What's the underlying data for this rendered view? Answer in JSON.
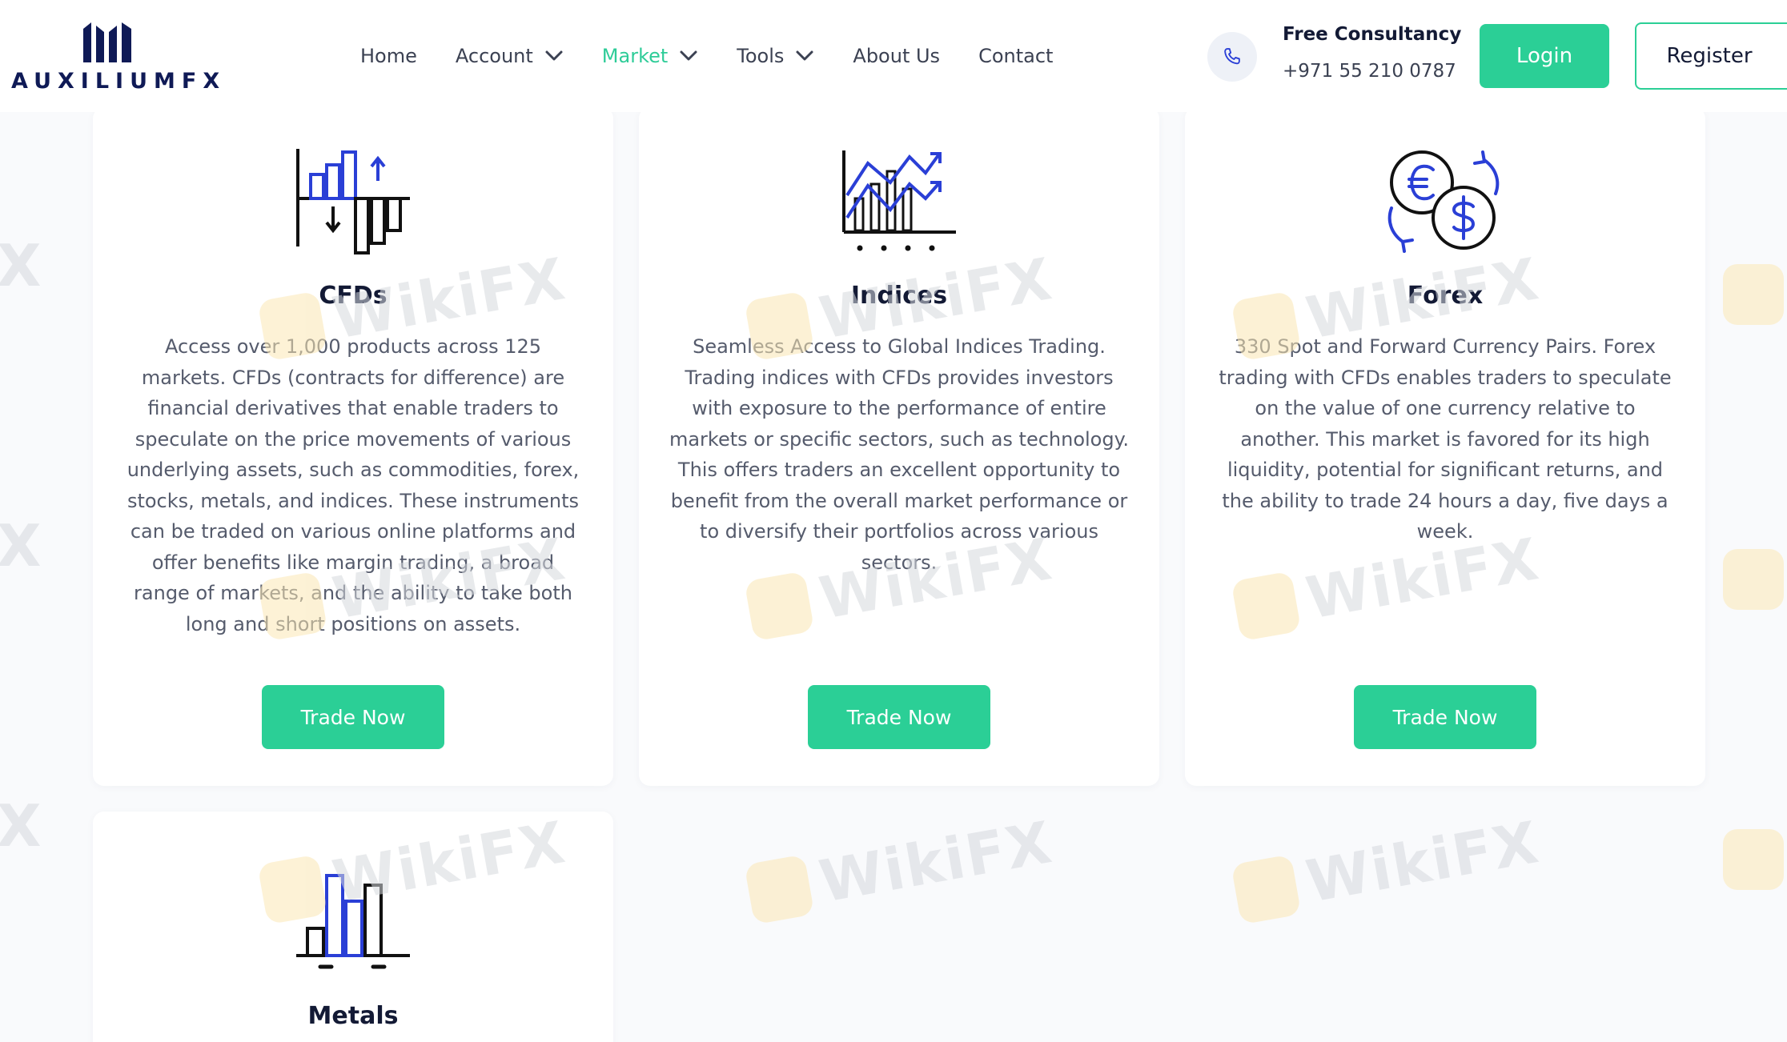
{
  "brand": {
    "name": "AUXILIUMFX",
    "colors": {
      "primary": "#2bcf96",
      "navy": "#0f1a56",
      "icon_blue": "#2a3fd6"
    }
  },
  "nav": {
    "items": [
      {
        "label": "Home",
        "dropdown": false,
        "active": false
      },
      {
        "label": "Account",
        "dropdown": true,
        "active": false
      },
      {
        "label": "Market",
        "dropdown": true,
        "active": true
      },
      {
        "label": "Tools",
        "dropdown": true,
        "active": false
      },
      {
        "label": "About Us",
        "dropdown": false,
        "active": false
      },
      {
        "label": "Contact",
        "dropdown": false,
        "active": false
      }
    ]
  },
  "contact": {
    "icon": "phone-icon",
    "title": "Free Consultancy",
    "phone": "+971 55 210 0787"
  },
  "auth": {
    "login_label": "Login",
    "register_label": "Register"
  },
  "markets": [
    {
      "icon": "cfd-bar-chart-icon",
      "title": "CFDs",
      "description": "Access over 1,000 products across 125 markets. CFDs (contracts for difference) are financial derivatives that enable traders to speculate on the price movements of various underlying assets, such as commodities, forex, stocks, metals, and indices. These instruments can be traded on various online platforms and offer benefits like margin trading, a broad range of markets, and the ability to take both long and short positions on assets.",
      "button_label": "Trade Now"
    },
    {
      "icon": "indices-line-chart-icon",
      "title": "Indices",
      "description": "Seamless Access to Global Indices Trading. Trading indices with CFDs provides investors with exposure to the performance of entire markets or specific sectors, such as technology. This offers traders an excellent opportunity to benefit from the overall market performance or to diversify their portfolios across various sectors.",
      "button_label": "Trade Now"
    },
    {
      "icon": "currency-exchange-icon",
      "title": "Forex",
      "description": "330 Spot and Forward Currency Pairs. Forex trading with CFDs enables traders to speculate on the value of one currency relative to another. This market is favored for its high liquidity, potential for significant returns, and the ability to trade 24 hours a day, five days a week.",
      "button_label": "Trade Now"
    },
    {
      "icon": "metals-bar-chart-icon",
      "title": "Metals"
    }
  ],
  "watermark": {
    "text": "WikiFX",
    "edge_text": "X"
  }
}
